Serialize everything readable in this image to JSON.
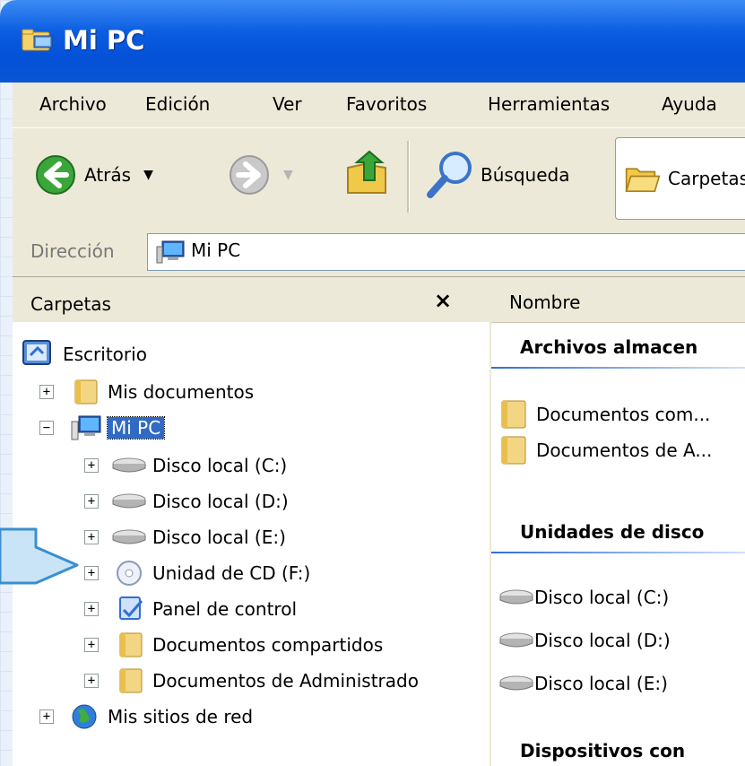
{
  "window": {
    "title": "Mi PC"
  },
  "menu": [
    "Archivo",
    "Edición",
    "Ver",
    "Favoritos",
    "Herramientas",
    "Ayuda"
  ],
  "toolbar": {
    "back": "Atrás",
    "search": "Búsqueda",
    "folders": "Carpetas"
  },
  "address": {
    "label": "Dirección",
    "value": "Mi PC"
  },
  "folders_pane": {
    "title": "Carpetas",
    "close": "×",
    "tree": [
      {
        "label": "Escritorio",
        "icon": "desktop-icon"
      },
      {
        "label": "Mis documentos",
        "icon": "folder-icon",
        "expander": "+"
      },
      {
        "label": "Mi PC",
        "icon": "computer-icon",
        "expander": "−",
        "selected": true
      },
      {
        "label": "Disco local (C:)",
        "icon": "drive-icon",
        "expander": "+"
      },
      {
        "label": "Disco local (D:)",
        "icon": "drive-icon",
        "expander": "+"
      },
      {
        "label": "Disco local (E:)",
        "icon": "drive-icon",
        "expander": "+"
      },
      {
        "label": "Unidad de CD (F:)",
        "icon": "cd-icon",
        "expander": "+"
      },
      {
        "label": "Panel de control",
        "icon": "control-panel-icon",
        "expander": "+"
      },
      {
        "label": "Documentos compartidos",
        "icon": "folder-icon",
        "expander": "+"
      },
      {
        "label": "Documentos de Administrado",
        "icon": "folder-icon",
        "expander": "+"
      },
      {
        "label": "Mis sitios de red",
        "icon": "network-icon",
        "expander": "+"
      }
    ]
  },
  "content": {
    "column": "Nombre",
    "group1": {
      "title": "Archivos almacen",
      "items": [
        "Documentos com...",
        "Documentos de A..."
      ]
    },
    "group2": {
      "title": "Unidades de disco",
      "items": [
        "Disco local (C:)",
        "Disco local (D:)",
        "Disco local (E:)"
      ]
    },
    "group3": {
      "title": "Dispositivos con"
    }
  }
}
